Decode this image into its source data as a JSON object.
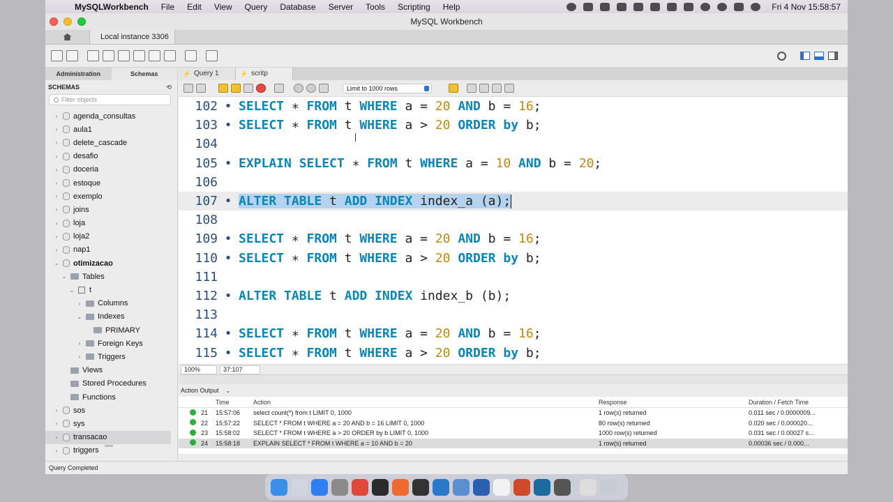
{
  "menubar": {
    "app_name": "MySQLWorkbench",
    "items": [
      "File",
      "Edit",
      "View",
      "Query",
      "Database",
      "Server",
      "Tools",
      "Scripting",
      "Help"
    ],
    "clock": "Fri 4 Nov  15:58:57"
  },
  "window": {
    "title": "MySQL Workbench",
    "connection_tab": "Local instance 3306"
  },
  "sidebar": {
    "tab_admin": "Administration",
    "tab_schemas": "Schemas",
    "header": "SCHEMAS",
    "filter_placeholder": "Filter objects",
    "tree": [
      {
        "label": "agenda_consultas",
        "level": 0,
        "type": "db",
        "expanded": false
      },
      {
        "label": "aula1",
        "level": 0,
        "type": "db",
        "expanded": false
      },
      {
        "label": "delete_cascade",
        "level": 0,
        "type": "db",
        "expanded": false
      },
      {
        "label": "desafio",
        "level": 0,
        "type": "db",
        "expanded": false
      },
      {
        "label": "doceria",
        "level": 0,
        "type": "db",
        "expanded": false
      },
      {
        "label": "estoque",
        "level": 0,
        "type": "db",
        "expanded": false
      },
      {
        "label": "exemplo",
        "level": 0,
        "type": "db",
        "expanded": false
      },
      {
        "label": "joins",
        "level": 0,
        "type": "db",
        "expanded": false
      },
      {
        "label": "loja",
        "level": 0,
        "type": "db",
        "expanded": false
      },
      {
        "label": "loja2",
        "level": 0,
        "type": "db",
        "expanded": false
      },
      {
        "label": "nap1",
        "level": 0,
        "type": "db",
        "expanded": false
      },
      {
        "label": "otimizacao",
        "level": 0,
        "type": "db",
        "expanded": true,
        "bold": true
      },
      {
        "label": "Tables",
        "level": 1,
        "type": "folder",
        "expanded": true
      },
      {
        "label": "t",
        "level": 2,
        "type": "table",
        "expanded": true
      },
      {
        "label": "Columns",
        "level": 3,
        "type": "folder",
        "expanded": false
      },
      {
        "label": "Indexes",
        "level": 3,
        "type": "folder",
        "expanded": true
      },
      {
        "label": "PRIMARY",
        "level": 4,
        "type": "folder",
        "leaf": true
      },
      {
        "label": "Foreign Keys",
        "level": 3,
        "type": "folder",
        "expanded": false
      },
      {
        "label": "Triggers",
        "level": 3,
        "type": "folder",
        "expanded": false
      },
      {
        "label": "Views",
        "level": 1,
        "type": "folder",
        "leaf": true
      },
      {
        "label": "Stored Procedures",
        "level": 1,
        "type": "folder",
        "leaf": true
      },
      {
        "label": "Functions",
        "level": 1,
        "type": "folder",
        "leaf": true
      },
      {
        "label": "sos",
        "level": 0,
        "type": "db",
        "expanded": false
      },
      {
        "label": "sys",
        "level": 0,
        "type": "db",
        "expanded": false
      },
      {
        "label": "transacao",
        "level": 0,
        "type": "db",
        "expanded": false,
        "selected": true
      },
      {
        "label": "triggers",
        "level": 0,
        "type": "db",
        "expanded": false
      }
    ]
  },
  "editor": {
    "tabs": [
      "Query 1",
      "scritp"
    ],
    "limit_label": "Limit to 1000 rows",
    "zoom": "100%",
    "position": "37:107",
    "lines": [
      {
        "n": "102",
        "dot": true,
        "tokens": [
          [
            "kw",
            "SELECT"
          ],
          [
            "t",
            " ∗ "
          ],
          [
            "kw",
            "FROM"
          ],
          [
            "t",
            " t "
          ],
          [
            "kw",
            "WHERE"
          ],
          [
            "t",
            " a = "
          ],
          [
            "num",
            "20"
          ],
          [
            "t",
            " "
          ],
          [
            "kw",
            "AND"
          ],
          [
            "t",
            " b = "
          ],
          [
            "num",
            "16"
          ],
          [
            "t",
            ";"
          ]
        ]
      },
      {
        "n": "103",
        "dot": true,
        "tokens": [
          [
            "kw",
            "SELECT"
          ],
          [
            "t",
            " ∗ "
          ],
          [
            "kw",
            "FROM"
          ],
          [
            "t",
            " t "
          ],
          [
            "kw",
            "WHERE"
          ],
          [
            "t",
            " a > "
          ],
          [
            "num",
            "20"
          ],
          [
            "t",
            " "
          ],
          [
            "kw",
            "ORDER"
          ],
          [
            "t",
            " "
          ],
          [
            "kw",
            "by"
          ],
          [
            "t",
            " b;"
          ]
        ]
      },
      {
        "n": "104",
        "dot": false,
        "tokens": []
      },
      {
        "n": "105",
        "dot": true,
        "tokens": [
          [
            "kw",
            "EXPLAIN"
          ],
          [
            "t",
            " "
          ],
          [
            "kw",
            "SELECT"
          ],
          [
            "t",
            " ∗ "
          ],
          [
            "kw",
            "FROM"
          ],
          [
            "t",
            " t "
          ],
          [
            "kw",
            "WHERE"
          ],
          [
            "t",
            " a = "
          ],
          [
            "num",
            "10"
          ],
          [
            "t",
            " "
          ],
          [
            "kw",
            "AND"
          ],
          [
            "t",
            " b = "
          ],
          [
            "num",
            "20"
          ],
          [
            "t",
            ";"
          ]
        ]
      },
      {
        "n": "106",
        "dot": false,
        "tokens": []
      },
      {
        "n": "107",
        "dot": true,
        "highlight": true,
        "tokens": [
          [
            "kw",
            "ALTER"
          ],
          [
            "t",
            " "
          ],
          [
            "kw",
            "TABLE"
          ],
          [
            "t",
            " t "
          ],
          [
            "kw",
            "ADD"
          ],
          [
            "t",
            " "
          ],
          [
            "kw",
            "INDEX"
          ],
          [
            "t",
            " index_a (a);"
          ]
        ]
      },
      {
        "n": "108",
        "dot": false,
        "tokens": []
      },
      {
        "n": "109",
        "dot": true,
        "tokens": [
          [
            "kw",
            "SELECT"
          ],
          [
            "t",
            " ∗ "
          ],
          [
            "kw",
            "FROM"
          ],
          [
            "t",
            " t "
          ],
          [
            "kw",
            "WHERE"
          ],
          [
            "t",
            " a = "
          ],
          [
            "num",
            "20"
          ],
          [
            "t",
            " "
          ],
          [
            "kw",
            "AND"
          ],
          [
            "t",
            " b = "
          ],
          [
            "num",
            "16"
          ],
          [
            "t",
            ";"
          ]
        ]
      },
      {
        "n": "110",
        "dot": true,
        "tokens": [
          [
            "kw",
            "SELECT"
          ],
          [
            "t",
            " ∗ "
          ],
          [
            "kw",
            "FROM"
          ],
          [
            "t",
            " t "
          ],
          [
            "kw",
            "WHERE"
          ],
          [
            "t",
            " a > "
          ],
          [
            "num",
            "20"
          ],
          [
            "t",
            " "
          ],
          [
            "kw",
            "ORDER"
          ],
          [
            "t",
            " "
          ],
          [
            "kw",
            "by"
          ],
          [
            "t",
            " b;"
          ]
        ]
      },
      {
        "n": "111",
        "dot": false,
        "tokens": []
      },
      {
        "n": "112",
        "dot": true,
        "tokens": [
          [
            "kw",
            "ALTER"
          ],
          [
            "t",
            " "
          ],
          [
            "kw",
            "TABLE"
          ],
          [
            "t",
            " t "
          ],
          [
            "kw",
            "ADD"
          ],
          [
            "t",
            " "
          ],
          [
            "kw",
            "INDEX"
          ],
          [
            "t",
            " index_b (b);"
          ]
        ]
      },
      {
        "n": "113",
        "dot": false,
        "tokens": []
      },
      {
        "n": "114",
        "dot": true,
        "tokens": [
          [
            "kw",
            "SELECT"
          ],
          [
            "t",
            " ∗ "
          ],
          [
            "kw",
            "FROM"
          ],
          [
            "t",
            " t "
          ],
          [
            "kw",
            "WHERE"
          ],
          [
            "t",
            " a = "
          ],
          [
            "num",
            "20"
          ],
          [
            "t",
            " "
          ],
          [
            "kw",
            "AND"
          ],
          [
            "t",
            " b = "
          ],
          [
            "num",
            "16"
          ],
          [
            "t",
            ";"
          ]
        ]
      },
      {
        "n": "115",
        "dot": true,
        "tokens": [
          [
            "kw",
            "SELECT"
          ],
          [
            "t",
            " ∗ "
          ],
          [
            "kw",
            "FROM"
          ],
          [
            "t",
            " t "
          ],
          [
            "kw",
            "WHERE"
          ],
          [
            "t",
            " a > "
          ],
          [
            "num",
            "20"
          ],
          [
            "t",
            " "
          ],
          [
            "kw",
            "ORDER"
          ],
          [
            "t",
            " "
          ],
          [
            "kw",
            "by"
          ],
          [
            "t",
            " b;"
          ]
        ]
      }
    ]
  },
  "output": {
    "selector": "Action Output",
    "columns": [
      "Time",
      "Action",
      "Response",
      "Duration / Fetch Time"
    ],
    "rows": [
      {
        "num": "21",
        "time": "15:57:06",
        "action": "select count(*) from t LIMIT 0, 1000",
        "response": "1 row(s) returned",
        "duration": "0.011 sec / 0.0000009..."
      },
      {
        "num": "22",
        "time": "15:57:22",
        "action": "SELECT * FROM t WHERE a = 20 AND b = 16 LIMIT 0, 1000",
        "response": "80 row(s) returned",
        "duration": "0.020 sec / 0.000020..."
      },
      {
        "num": "23",
        "time": "15:58:02",
        "action": "SELECT * FROM t WHERE a > 20 ORDER by b LIMIT 0, 1000",
        "response": "1000 row(s) returned",
        "duration": "0.031 sec / 0.00027 s..."
      },
      {
        "num": "24",
        "time": "15:58:18",
        "action": "EXPLAIN SELECT * FROM t WHERE a = 10 AND b = 20",
        "response": "1 row(s) returned",
        "duration": "0.00036 sec / 0.000...",
        "active": true
      }
    ]
  },
  "status": {
    "text": "Query Completed"
  },
  "colors": {
    "keyword": "#0a86b5",
    "number": "#c08a10",
    "selection": "#b5d2ee",
    "success": "#2fae3c"
  },
  "dock": [
    "finder-icon",
    "launchpad-icon",
    "appstore-icon",
    "settings-icon",
    "chrome-icon",
    "terminal-icon",
    "postman-icon",
    "activity-icon",
    "vscode-icon",
    "workbench-icon",
    "word-icon",
    "textedit-icon",
    "powerpoint-icon",
    "mysql-icon",
    "quicktime-icon",
    "preview-icon",
    "trash-icon"
  ]
}
